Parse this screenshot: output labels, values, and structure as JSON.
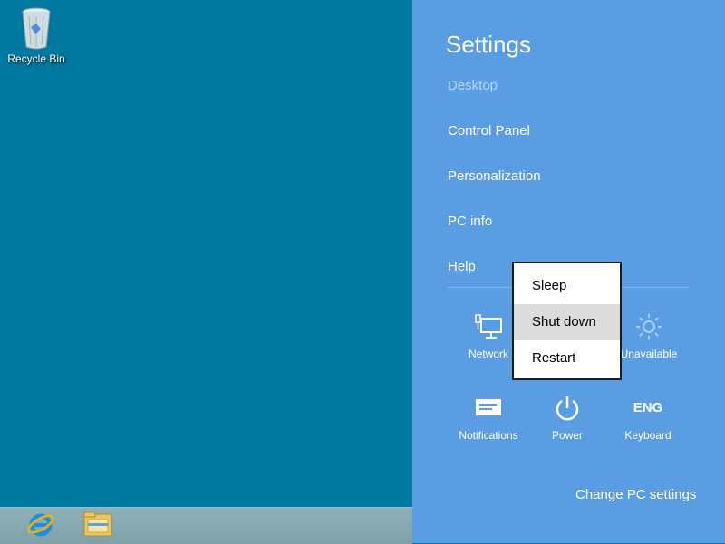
{
  "desktop": {
    "recycle_bin_label": "Recycle Bin"
  },
  "taskbar": {
    "items": [
      "internet-explorer-icon",
      "file-explorer-icon"
    ]
  },
  "settings": {
    "title": "Settings",
    "items": [
      {
        "label": "Desktop",
        "enabled": false
      },
      {
        "label": "Control Panel",
        "enabled": true
      },
      {
        "label": "Personalization",
        "enabled": true
      },
      {
        "label": "PC info",
        "enabled": true
      },
      {
        "label": "Help",
        "enabled": true
      }
    ],
    "tiles": [
      {
        "label": "Network",
        "icon": "network-icon"
      },
      {
        "label": "Unavailable",
        "icon": "brightness-icon"
      },
      {
        "label": "Notifications",
        "icon": "notifications-icon"
      },
      {
        "label": "Power",
        "icon": "power-icon"
      },
      {
        "label": "Keyboard",
        "icon_text": "ENG"
      }
    ],
    "change_pc_settings": "Change PC settings"
  },
  "power_menu": {
    "items": [
      "Sleep",
      "Shut down",
      "Restart"
    ],
    "selected": "Shut down"
  },
  "colors": {
    "desktop_bg": "#00789f",
    "charm_bg": "#5a9de2",
    "menu_highlight": "#dcdcdc"
  }
}
